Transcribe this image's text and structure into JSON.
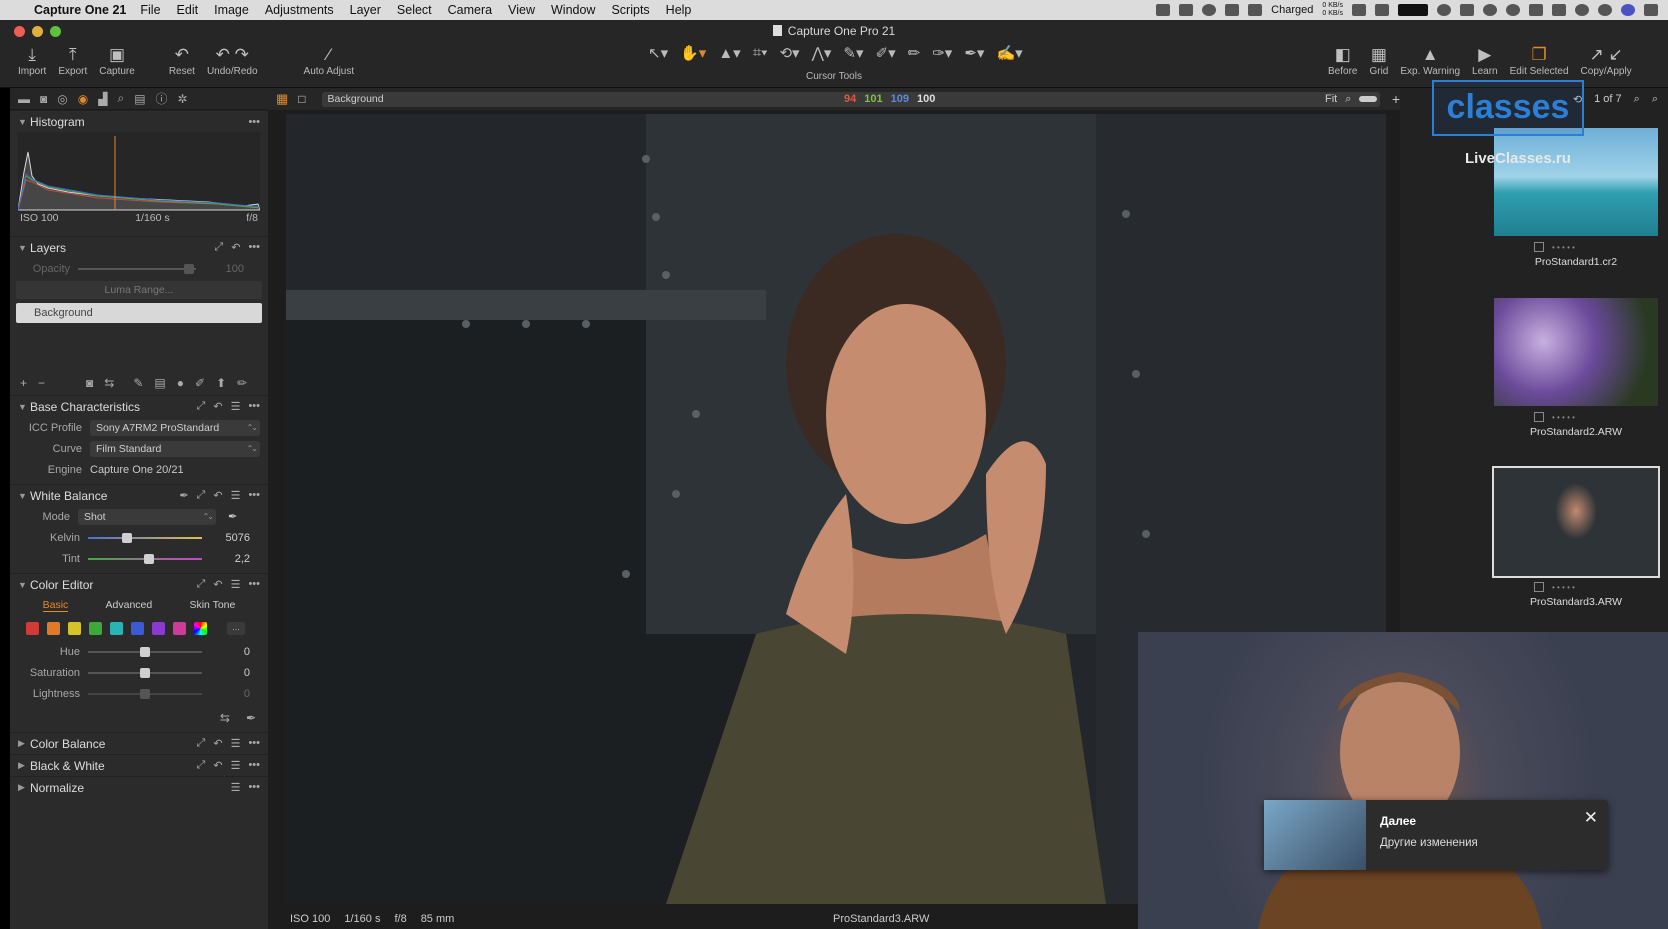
{
  "menubar": {
    "app_name": "Capture One 21",
    "items": [
      "File",
      "Edit",
      "Image",
      "Adjustments",
      "Layer",
      "Select",
      "Camera",
      "View",
      "Window",
      "Scripts",
      "Help"
    ],
    "battery_label": "Charged",
    "net_up": "0 KB/s",
    "net_down": "0 KB/s"
  },
  "window": {
    "title": "Capture One Pro 21"
  },
  "toolbar": {
    "left": [
      {
        "label": "Import",
        "icon": "import-icon"
      },
      {
        "label": "Export",
        "icon": "export-icon"
      },
      {
        "label": "Capture",
        "icon": "camera-icon"
      },
      {
        "label": "Reset",
        "icon": "reset-icon"
      },
      {
        "label": "Undo/Redo",
        "icon": "undo-icon"
      },
      {
        "label": "Auto Adjust",
        "icon": "wand-icon"
      }
    ],
    "cursor_tools_label": "Cursor Tools",
    "right": [
      {
        "label": "Before",
        "icon": "before-icon"
      },
      {
        "label": "Grid",
        "icon": "grid-icon"
      },
      {
        "label": "Exp. Warning",
        "icon": "warning-icon"
      },
      {
        "label": "Learn",
        "icon": "learn-icon"
      },
      {
        "label": "Edit Selected",
        "icon": "edit-selected-icon"
      },
      {
        "label": "Copy/Apply",
        "icon": "copy-apply-icon"
      }
    ]
  },
  "viewer": {
    "layer_select": "Background",
    "rgb": {
      "r": "94",
      "g": "101",
      "b": "109",
      "l": "100"
    },
    "zoom": "Fit",
    "footer": {
      "iso": "ISO 100",
      "shutter": "1/160 s",
      "aperture": "f/8",
      "focal": "85 mm",
      "filename": "ProStandard3.ARW"
    }
  },
  "browser": {
    "counter": "1 of 7",
    "thumbs": [
      {
        "name": "ProStandard1.cr2",
        "stars": "• • • • •"
      },
      {
        "name": "ProStandard2.ARW",
        "stars": "• • • • •"
      },
      {
        "name": "ProStandard3.ARW",
        "stars": "• • • • •"
      }
    ]
  },
  "watermark": {
    "logo": "classes",
    "url": "LiveClasses.ru"
  },
  "panel": {
    "histogram": {
      "title": "Histogram",
      "iso": "ISO 100",
      "shutter": "1/160 s",
      "aperture": "f/8"
    },
    "layers": {
      "title": "Layers",
      "opacity_label": "Opacity",
      "opacity_value": "100",
      "luma": "Luma Range...",
      "layer_name": "Background"
    },
    "base": {
      "title": "Base Characteristics",
      "icc_label": "ICC Profile",
      "icc_value": "Sony A7RM2 ProStandard",
      "curve_label": "Curve",
      "curve_value": "Film Standard",
      "engine_label": "Engine",
      "engine_value": "Capture One 20/21"
    },
    "wb": {
      "title": "White Balance",
      "mode_label": "Mode",
      "mode_value": "Shot",
      "kelvin_label": "Kelvin",
      "kelvin_value": "5076",
      "tint_label": "Tint",
      "tint_value": "2,2"
    },
    "color_editor": {
      "title": "Color Editor",
      "tabs": [
        "Basic",
        "Advanced",
        "Skin Tone"
      ],
      "swatch_more": "...",
      "hue_label": "Hue",
      "hue_value": "0",
      "sat_label": "Saturation",
      "sat_value": "0",
      "light_label": "Lightness",
      "light_value": "0"
    },
    "collapsed": [
      "Color Balance",
      "Black & White",
      "Normalize"
    ]
  },
  "popup": {
    "title": "Далее",
    "subtitle": "Другие изменения"
  }
}
